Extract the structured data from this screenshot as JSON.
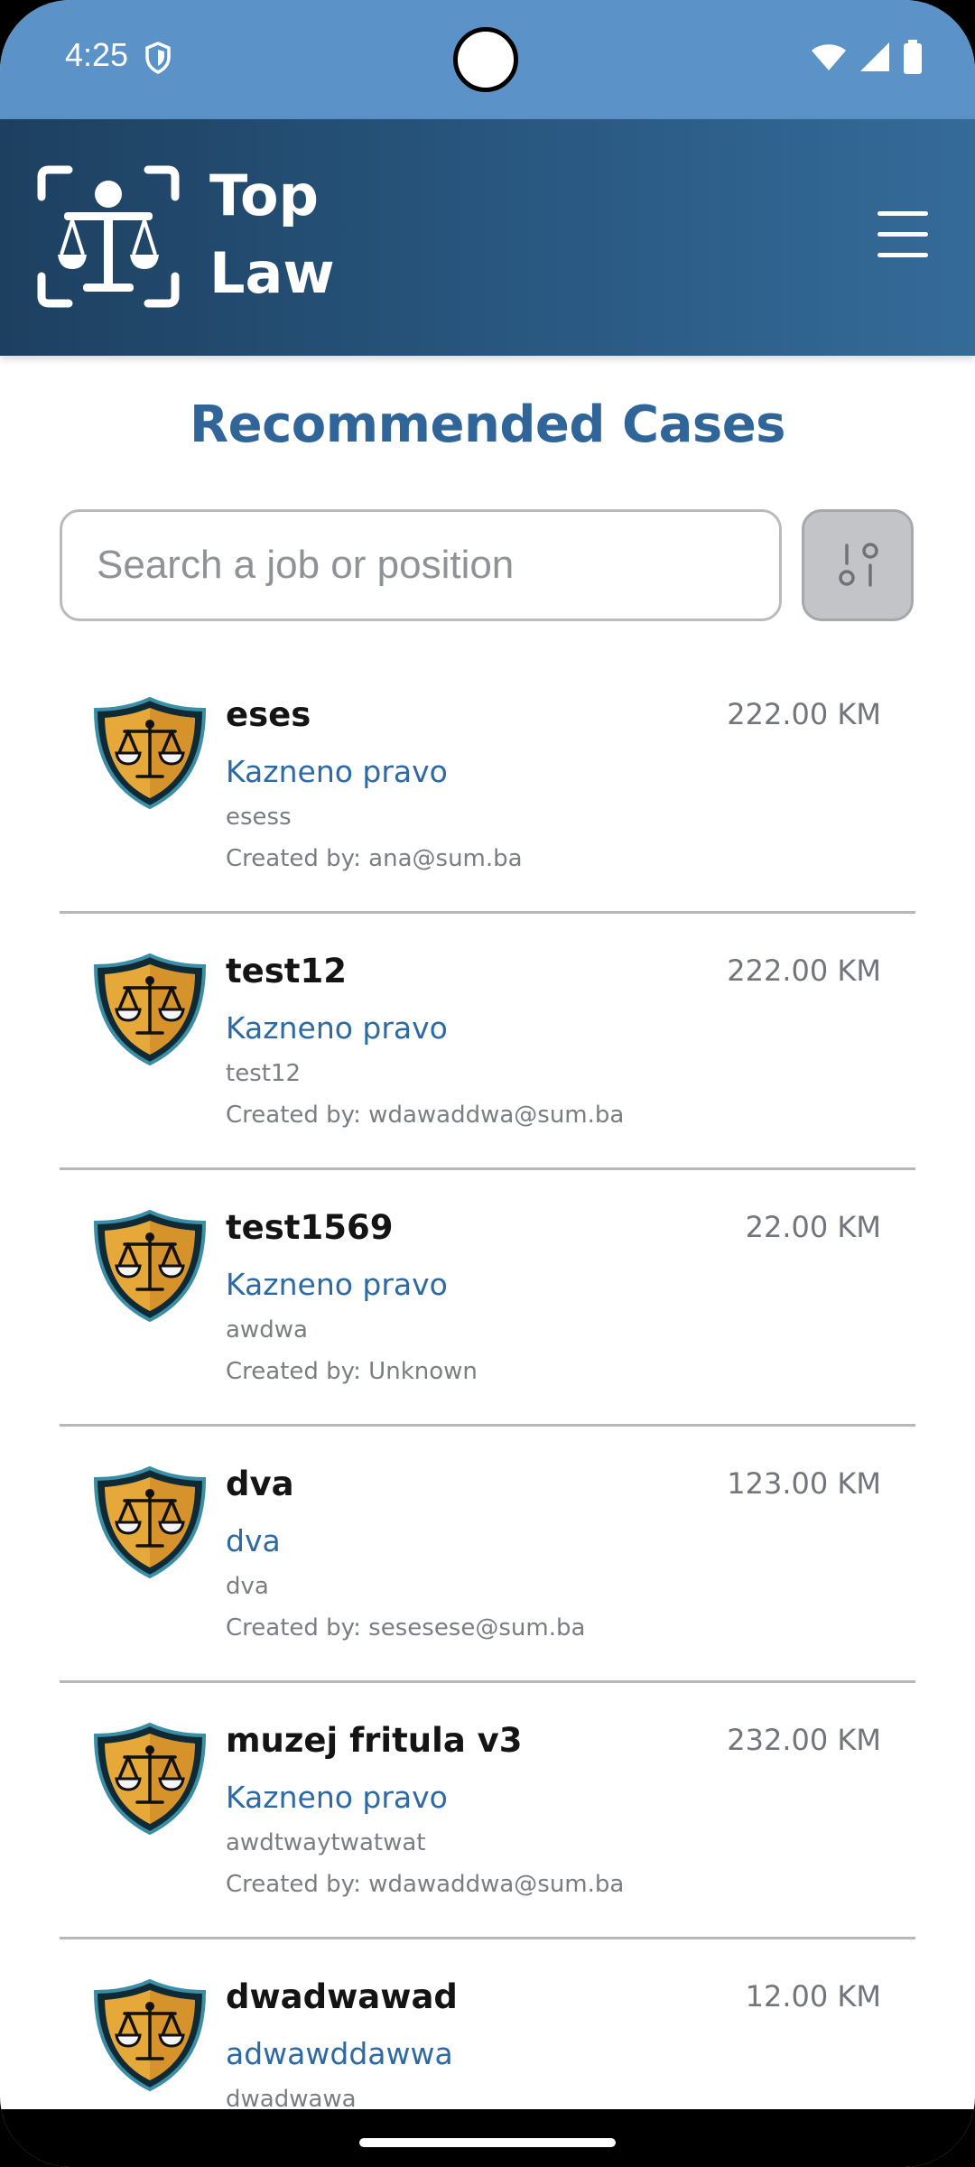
{
  "status": {
    "time": "4:25"
  },
  "header": {
    "brand_line1": "Top",
    "brand_line2": "Law"
  },
  "page": {
    "title": "Recommended Cases"
  },
  "search": {
    "placeholder": "Search a job or position"
  },
  "cases": [
    {
      "title": "eses",
      "price": "222.00 KM",
      "category": "Kazneno pravo",
      "description": "esess",
      "created_by": "Created by: ana@sum.ba"
    },
    {
      "title": "test12",
      "price": "222.00 KM",
      "category": "Kazneno pravo",
      "description": "test12",
      "created_by": "Created by: wdawaddwa@sum.ba"
    },
    {
      "title": "test1569",
      "price": "22.00 KM",
      "category": "Kazneno pravo",
      "description": "awdwa",
      "created_by": "Created by: Unknown"
    },
    {
      "title": "dva",
      "price": "123.00 KM",
      "category": "dva",
      "description": "dva",
      "created_by": "Created by: sesesese@sum.ba"
    },
    {
      "title": "muzej fritula v3",
      "price": "232.00 KM",
      "category": "Kazneno pravo",
      "description": "awdtwaytwatwat",
      "created_by": "Created by: wdawaddwa@sum.ba"
    },
    {
      "title": "dwadwawad",
      "price": "12.00 KM",
      "category": "adwawddawwa",
      "description": "dwadwawa",
      "created_by": ""
    }
  ],
  "colors": {
    "accent": "#2f6598",
    "status_bar": "#5b92c8",
    "header_dark": "#1d4060",
    "category": "#2d6aa3"
  }
}
